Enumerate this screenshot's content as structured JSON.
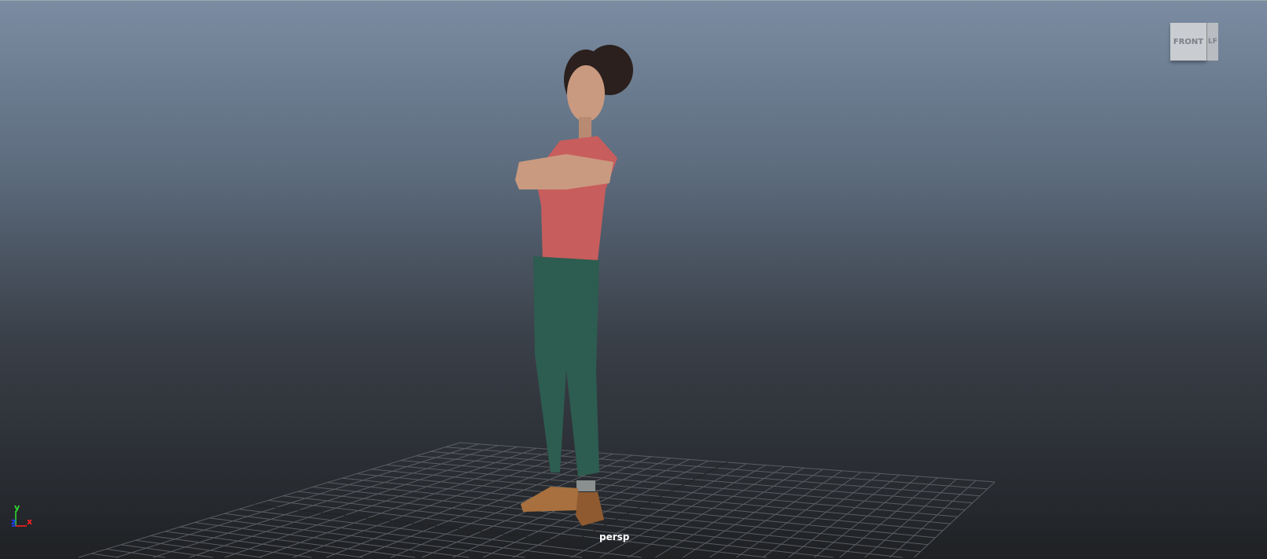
{
  "viewport": {
    "camera_label": "persp"
  },
  "viewcube": {
    "front_label": "FRONT",
    "side_label": "LF"
  },
  "axis": {
    "x": "x",
    "y": "y",
    "z": "z",
    "x_color": "#ff2020",
    "y_color": "#30e030",
    "z_color": "#2040ff"
  },
  "colors": {
    "shirt": "#c85d5d",
    "pants": "#2d5c50",
    "skin": "#c99a80",
    "hair": "#2b201d",
    "shoes": "#a8703e"
  }
}
